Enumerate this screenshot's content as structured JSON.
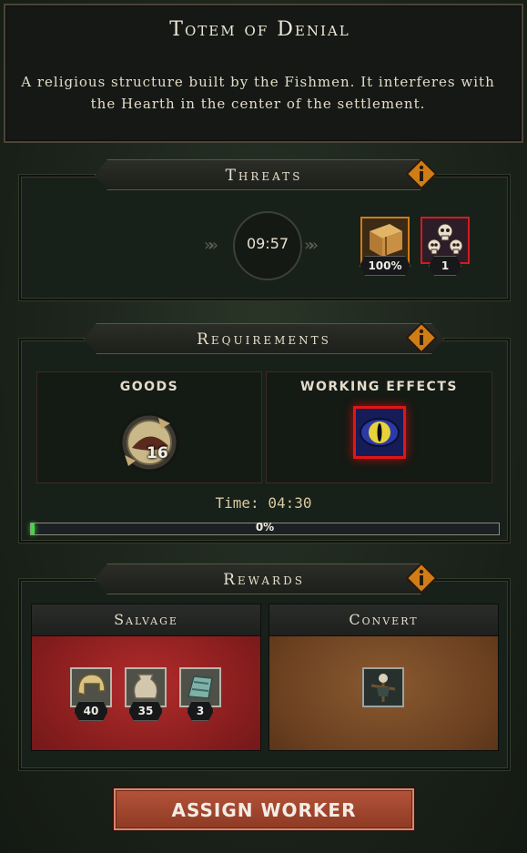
{
  "building": {
    "title": "Totem of Denial",
    "description": "A religious structure built by the Fishmen. It interferes with the Hearth in the center of the settlement."
  },
  "threats": {
    "header": "Threats",
    "timer": "09:57",
    "icons": [
      {
        "icon": "crate-icon",
        "value": "100%"
      },
      {
        "icon": "skulls-icon",
        "value": "1"
      }
    ]
  },
  "requirements": {
    "header": "Requirements",
    "goods_label": "GOODS",
    "goods_count": "16",
    "effects_label": "WORKING EFFECTS",
    "effect_icon": "eye-icon",
    "time_label": "Time: 04:30",
    "progress_text": "0%",
    "progress_fraction": 0
  },
  "rewards": {
    "header": "Rewards",
    "salvage_label": "Salvage",
    "salvage_items": [
      {
        "icon": "helmet-icon",
        "count": "40"
      },
      {
        "icon": "pot-icon",
        "count": "35"
      },
      {
        "icon": "fabric-icon",
        "count": "3"
      }
    ],
    "convert_label": "Convert",
    "convert_icon": "scarecrow-icon"
  },
  "actions": {
    "assign_worker": "ASSIGN WORKER"
  },
  "colors": {
    "accent_orange": "#d17a18",
    "danger_red": "#d41b1b",
    "progress_green": "#4bd24b",
    "button_red": "#a44a32"
  }
}
